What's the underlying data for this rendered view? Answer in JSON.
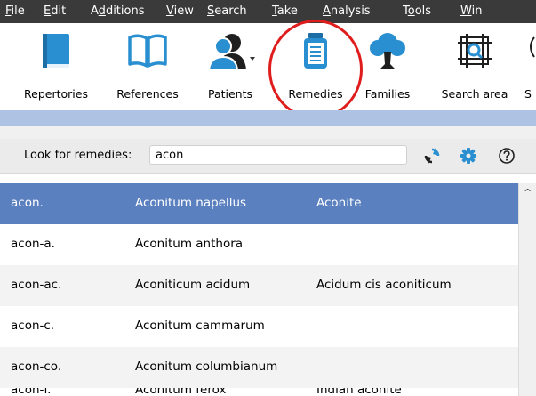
{
  "menu": {
    "items": [
      {
        "id": "file",
        "pre": "",
        "acc": "F",
        "post": "ile"
      },
      {
        "id": "edit",
        "pre": "",
        "acc": "E",
        "post": "dit"
      },
      {
        "id": "additions",
        "pre": "A",
        "acc": "d",
        "post": "ditions"
      },
      {
        "id": "view",
        "pre": "",
        "acc": "V",
        "post": "iew"
      },
      {
        "id": "search",
        "pre": "",
        "acc": "S",
        "post": "earch"
      },
      {
        "id": "take",
        "pre": "",
        "acc": "T",
        "post": "ake"
      },
      {
        "id": "analysis",
        "pre": "",
        "acc": "A",
        "post": "nalysis"
      },
      {
        "id": "tools",
        "pre": "T",
        "acc": "o",
        "post": "ols"
      },
      {
        "id": "window",
        "pre": "",
        "acc": "W",
        "post": "in"
      }
    ]
  },
  "toolbar": {
    "repertories": "Repertories",
    "references": "References",
    "patients": "Patients",
    "remedies": "Remedies",
    "families": "Families",
    "search_area": "Search area",
    "cut_label": "S"
  },
  "search": {
    "label": "Look for remedies:",
    "value": "acon"
  },
  "colors": {
    "menubar": "#3a3a3a",
    "selected_row": "#5b80bf",
    "highlight": "#e01d1d",
    "icon_blue": "#2a8fd0"
  },
  "remedies": [
    {
      "abbr": "acon.",
      "name": "Aconitum napellus",
      "common": "Aconite"
    },
    {
      "abbr": "acon-a.",
      "name": "Aconitum anthora",
      "common": ""
    },
    {
      "abbr": "acon-ac.",
      "name": "Aconiticum acidum",
      "common": "Acidum cis aconiticum"
    },
    {
      "abbr": "acon-c.",
      "name": "Aconitum cammarum",
      "common": ""
    },
    {
      "abbr": "acon-co.",
      "name": "Aconitum columbianum",
      "common": ""
    },
    {
      "abbr": "acon-f.",
      "name": "Aconitum ferox",
      "common": "Indian aconite"
    }
  ]
}
